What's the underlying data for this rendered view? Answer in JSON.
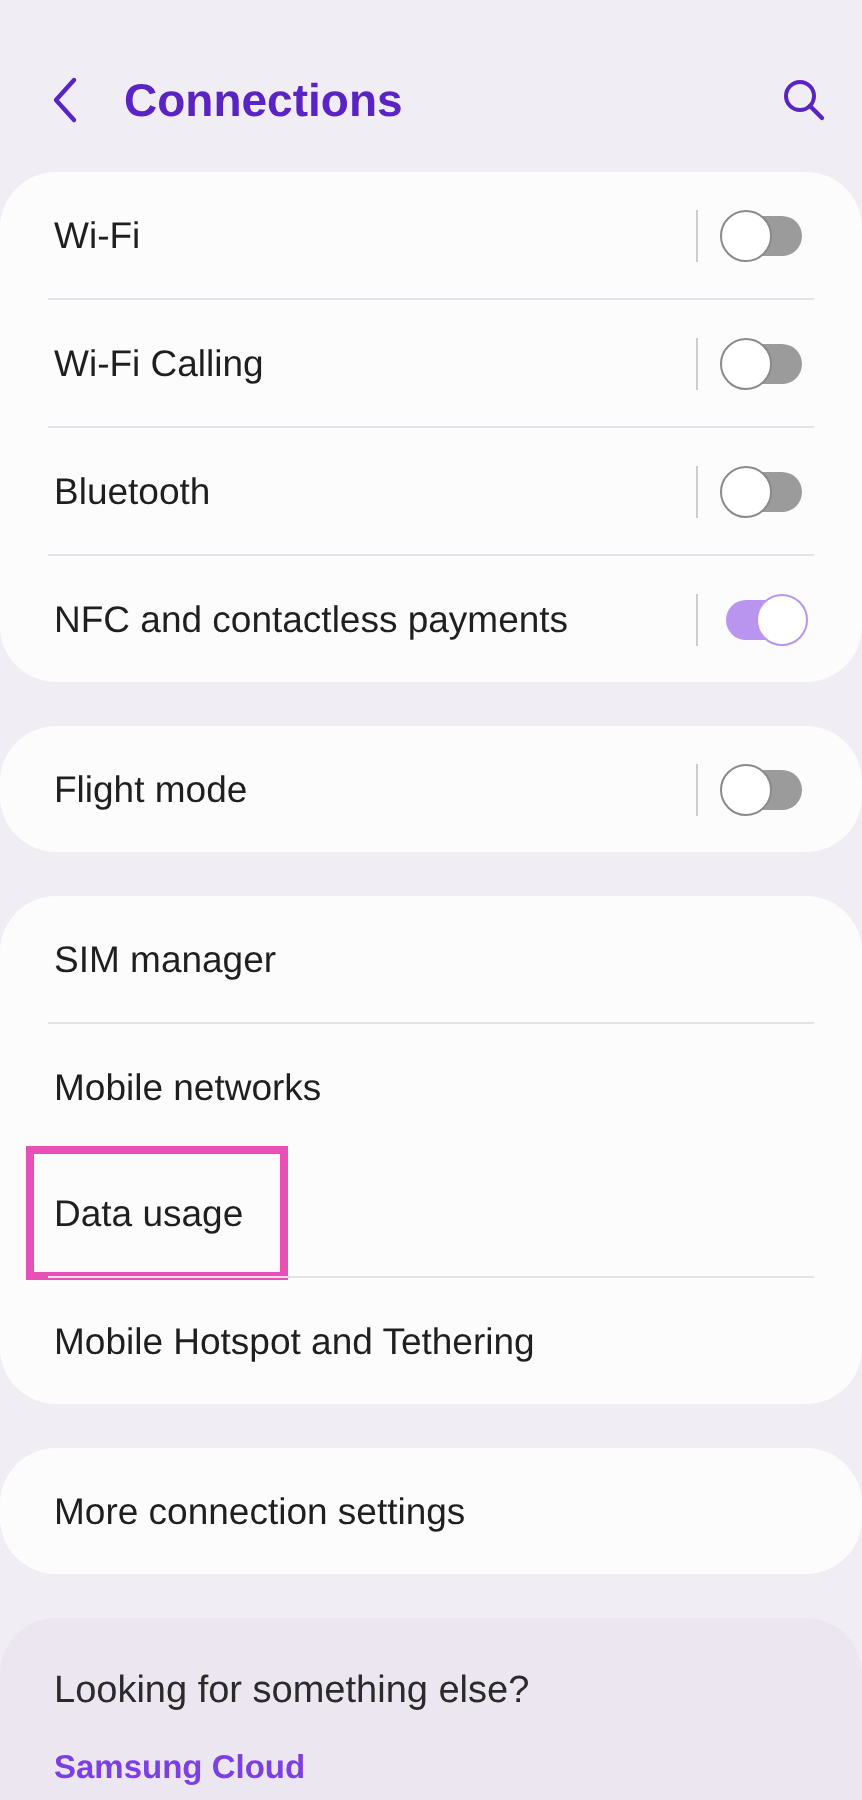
{
  "header": {
    "title": "Connections"
  },
  "groups": [
    {
      "items": [
        {
          "label": "Wi-Fi",
          "kind": "toggle",
          "on": false,
          "highlighted": false
        },
        {
          "label": "Wi-Fi Calling",
          "kind": "toggle",
          "on": false,
          "highlighted": false
        },
        {
          "label": "Bluetooth",
          "kind": "toggle",
          "on": false,
          "highlighted": false
        },
        {
          "label": "NFC and contactless payments",
          "kind": "toggle",
          "on": true,
          "highlighted": false
        }
      ]
    },
    {
      "items": [
        {
          "label": "Flight mode",
          "kind": "toggle",
          "on": false,
          "highlighted": false
        }
      ]
    },
    {
      "items": [
        {
          "label": "SIM manager",
          "kind": "link",
          "highlighted": false
        },
        {
          "label": "Mobile networks",
          "kind": "link",
          "highlighted": false
        },
        {
          "label": "Data usage",
          "kind": "link",
          "highlighted": true
        },
        {
          "label": "Mobile Hotspot and Tethering",
          "kind": "link",
          "highlighted": false
        }
      ]
    },
    {
      "items": [
        {
          "label": "More connection settings",
          "kind": "link",
          "highlighted": false
        }
      ]
    }
  ],
  "suggestions": {
    "title": "Looking for something else?",
    "links": [
      "Samsung Cloud"
    ]
  }
}
